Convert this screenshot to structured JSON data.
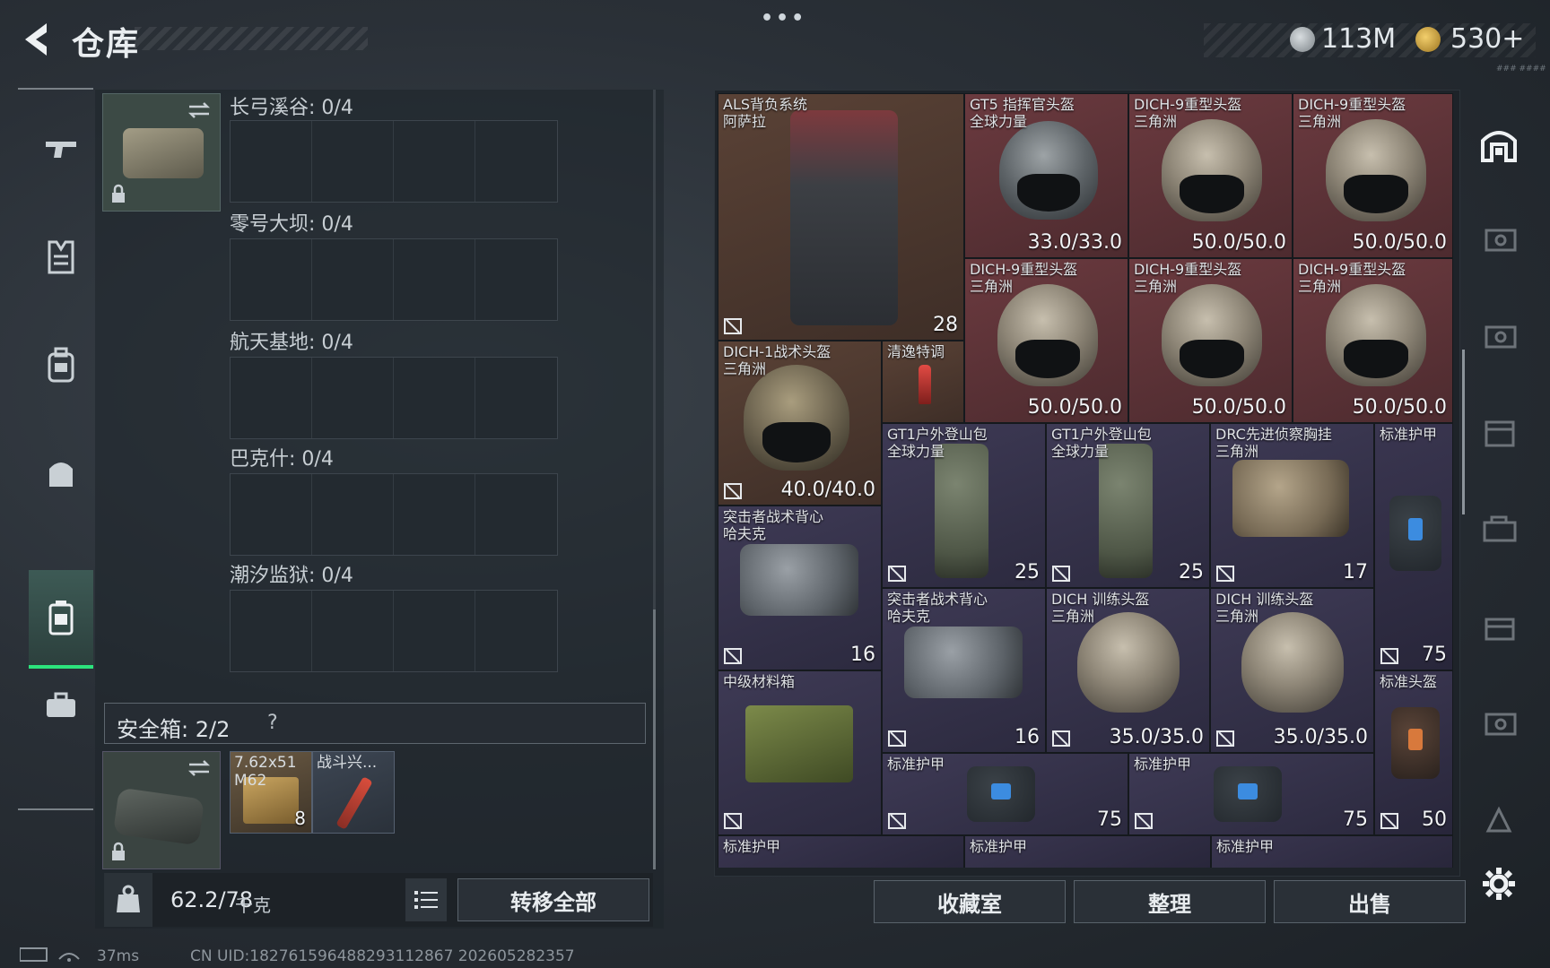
{
  "header": {
    "title": "仓库",
    "menu_dots": "•••",
    "money": "113M",
    "coupons": "530+",
    "tiny": "### ####"
  },
  "left_nav": {
    "items": [
      {
        "name": "weapons",
        "icon": "gun-icon"
      },
      {
        "name": "armor",
        "icon": "vest-icon"
      },
      {
        "name": "backpack",
        "icon": "backpack-icon"
      },
      {
        "name": "chest-rig",
        "icon": "bag-icon"
      },
      {
        "name": "safebox",
        "icon": "case-icon",
        "active": true
      },
      {
        "name": "briefcase",
        "icon": "briefcase-icon"
      }
    ]
  },
  "maps": [
    {
      "label": "长弓溪谷: 0/4"
    },
    {
      "label": "零号大坝: 0/4"
    },
    {
      "label": "航天基地: 0/4"
    },
    {
      "label": "巴克什: 0/4"
    },
    {
      "label": "潮汐监狱: 0/4"
    }
  ],
  "safe_box": {
    "label": "安全箱:  2/2",
    "help": "?",
    "items": [
      {
        "name": "7.62x51\nM62",
        "count": "8"
      },
      {
        "name": "战斗兴..."
      }
    ]
  },
  "weight": {
    "value": "62.2/78",
    "unit": "千克"
  },
  "buttons": {
    "transfer_all": "转移全部",
    "collection": "收藏室",
    "sort": "整理",
    "sell": "出售"
  },
  "inventory": [
    {
      "name": "ALS背负系统\n阿萨拉",
      "value": "28"
    },
    {
      "name": "GT5 指挥官头盔\n全球力量",
      "value": "33.0/33.0"
    },
    {
      "name": "DICH-9重型头盔\n三角洲",
      "value": "50.0/50.0"
    },
    {
      "name": "DICH-9重型头盔\n三角洲",
      "value": "50.0/50.0"
    },
    {
      "name": "DICH-9重型头盔\n三角洲",
      "value": "50.0/50.0"
    },
    {
      "name": "DICH-9重型头盔\n三角洲",
      "value": "50.0/50.0"
    },
    {
      "name": "DICH-9重型头盔\n三角洲",
      "value": "50.0/50.0"
    },
    {
      "name": "DICH-1战术头盔\n三角洲",
      "value": "40.0/40.0"
    },
    {
      "name": "清逸特调",
      "value": ""
    },
    {
      "name": "GT1户外登山包\n全球力量",
      "value": "25"
    },
    {
      "name": "GT1户外登山包\n全球力量",
      "value": "25"
    },
    {
      "name": "DRC先进侦察胸挂\n三角洲",
      "value": "17"
    },
    {
      "name": "标准护甲",
      "value": "75"
    },
    {
      "name": "突击者战术背心\n哈夫克",
      "value": "16"
    },
    {
      "name": "突击者战术背心\n哈夫克",
      "value": "16"
    },
    {
      "name": "DICH 训练头盔\n三角洲",
      "value": "35.0/35.0"
    },
    {
      "name": "DICH 训练头盔\n三角洲",
      "value": "35.0/35.0"
    },
    {
      "name": "标准头盔",
      "value": "50"
    },
    {
      "name": "中级材料箱",
      "value": ""
    },
    {
      "name": "标准护甲",
      "value": "75"
    },
    {
      "name": "标准护甲",
      "value": "75"
    },
    {
      "name": "标准护甲",
      "value": ""
    },
    {
      "name": "标准护甲",
      "value": ""
    },
    {
      "name": "标准护甲",
      "value": ""
    }
  ],
  "status": {
    "ping": "37ms",
    "uid": "CN UID:1827615964882931128​67 202605282357"
  },
  "colors": {
    "accent_green": "#2ce37c",
    "rarity_red": "#6b3a3f",
    "rarity_purple": "#3e3a55"
  }
}
